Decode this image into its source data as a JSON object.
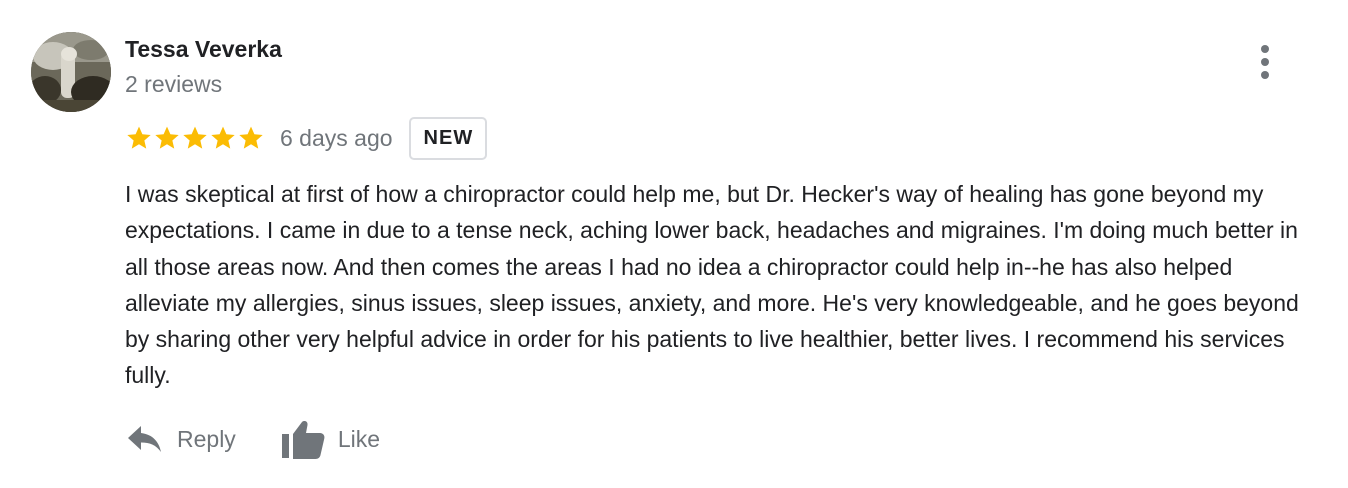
{
  "review": {
    "author": {
      "name": "Tessa Veverka",
      "meta": "2 reviews",
      "avatar_icon": "profile-photo"
    },
    "rating": 5,
    "rating_max": 5,
    "date": "6 days ago",
    "badge": "NEW",
    "text": "I was skeptical at first of how a chiropractor could help me, but Dr. Hecker's way of healing has gone beyond my expectations. I came in due to a tense neck, aching lower back, headaches and migraines. I'm doing much better in all those areas now. And then comes the areas I had no idea a chiropractor could help in--he has also helped alleviate my allergies, sinus issues, sleep issues, anxiety, and more. He's very knowledgeable, and he goes beyond by sharing other very helpful advice in order for his patients to live healthier, better lives. I recommend his services fully.",
    "actions": {
      "reply_label": "Reply",
      "reply_icon": "reply-arrow-icon",
      "like_label": "Like",
      "like_icon": "thumbs-up-icon"
    },
    "more_icon": "more-vert-icon"
  },
  "colors": {
    "star": "#fbbc04",
    "text": "#202124",
    "secondary": "#70757a",
    "badge_border": "#dadce0"
  }
}
